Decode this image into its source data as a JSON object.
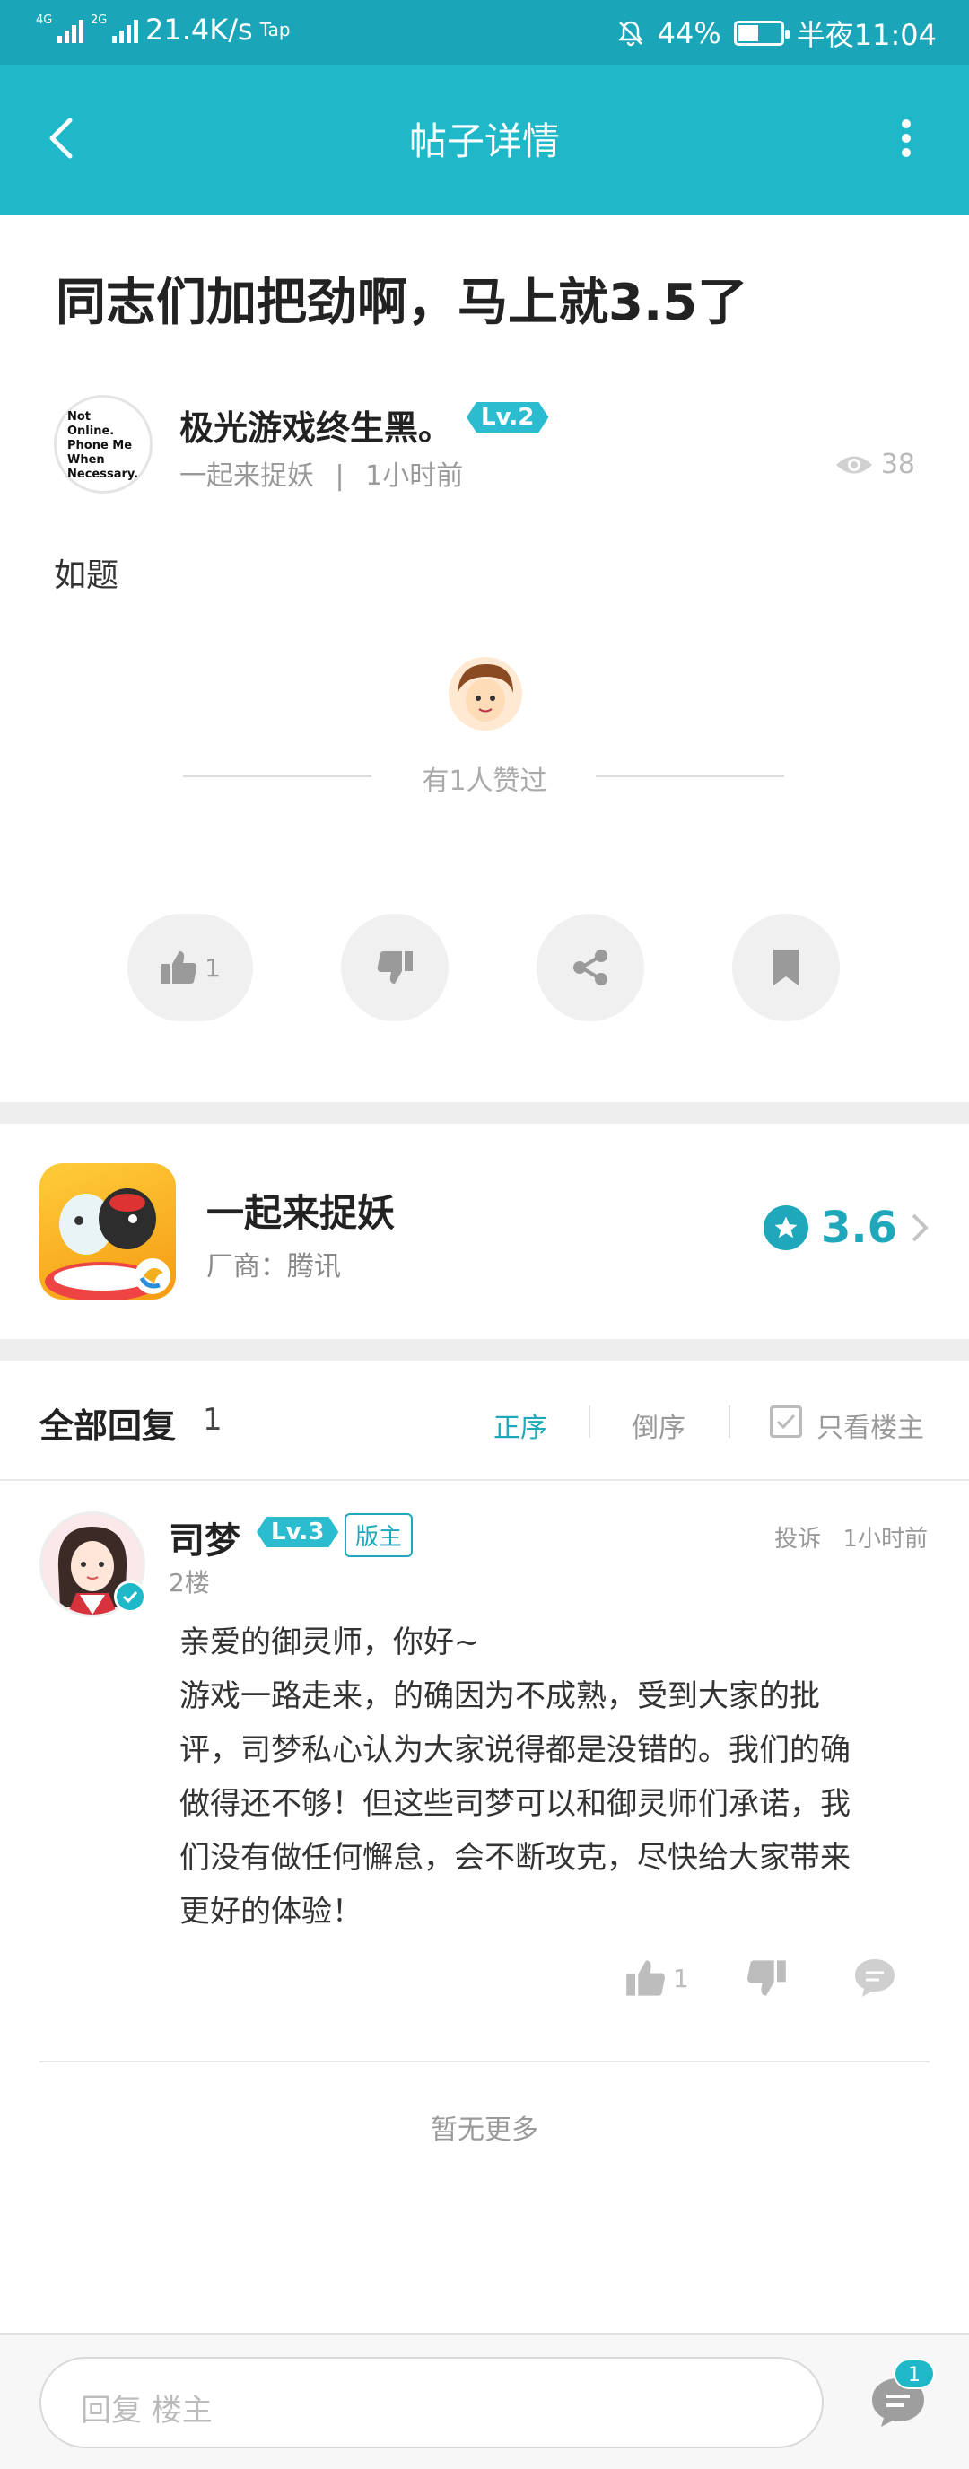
{
  "status_bar": {
    "net1": "4G",
    "net2": "2G",
    "speed": "21.4K/s",
    "tap": "Tap",
    "battery": "44%",
    "time": "半夜11:04"
  },
  "header": {
    "title": "帖子详情"
  },
  "post": {
    "title": "同志们加把劲啊，马上就3.5了",
    "author": {
      "name": "极光游戏终生黑。",
      "level": "Lv.2",
      "avatar_text": [
        "Not Online.",
        "Phone Me",
        "When",
        "Necessary."
      ],
      "game": "一起来捉妖",
      "sep": "|",
      "time": "1小时前"
    },
    "views": "38",
    "body": "如题",
    "liked_text": "有1人赞过",
    "like_count": "1"
  },
  "game": {
    "name": "一起来捉妖",
    "vendor": "厂商：腾讯",
    "score": "3.6"
  },
  "replies": {
    "header": "全部回复",
    "count": "1",
    "sort_asc": "正序",
    "sort_desc": "倒序",
    "only_owner": "只看楼主",
    "items": [
      {
        "name": "司梦",
        "level": "Lv.3",
        "badge": "版主",
        "floor": "2楼",
        "report": "投诉",
        "time": "1小时前",
        "lines": [
          "亲爱的御灵师，你好~",
          "游戏一路走来，的确因为不成熟，受到大家的批",
          "评，司梦私心认为大家说得都是没错的。我们的确",
          "做得还不够！但这些司梦可以和御灵师们承诺，我",
          "们没有做任何懈怠，会不断攻克，尽快给大家带来",
          "更好的体验！"
        ],
        "like_count": "1"
      }
    ],
    "no_more": "暂无更多"
  },
  "bottom_bar": {
    "reply_placeholder": "回复  楼主",
    "message_badge": "1"
  },
  "colors": {
    "accent": "#1fb8c9",
    "score": "#1fa8bb"
  }
}
